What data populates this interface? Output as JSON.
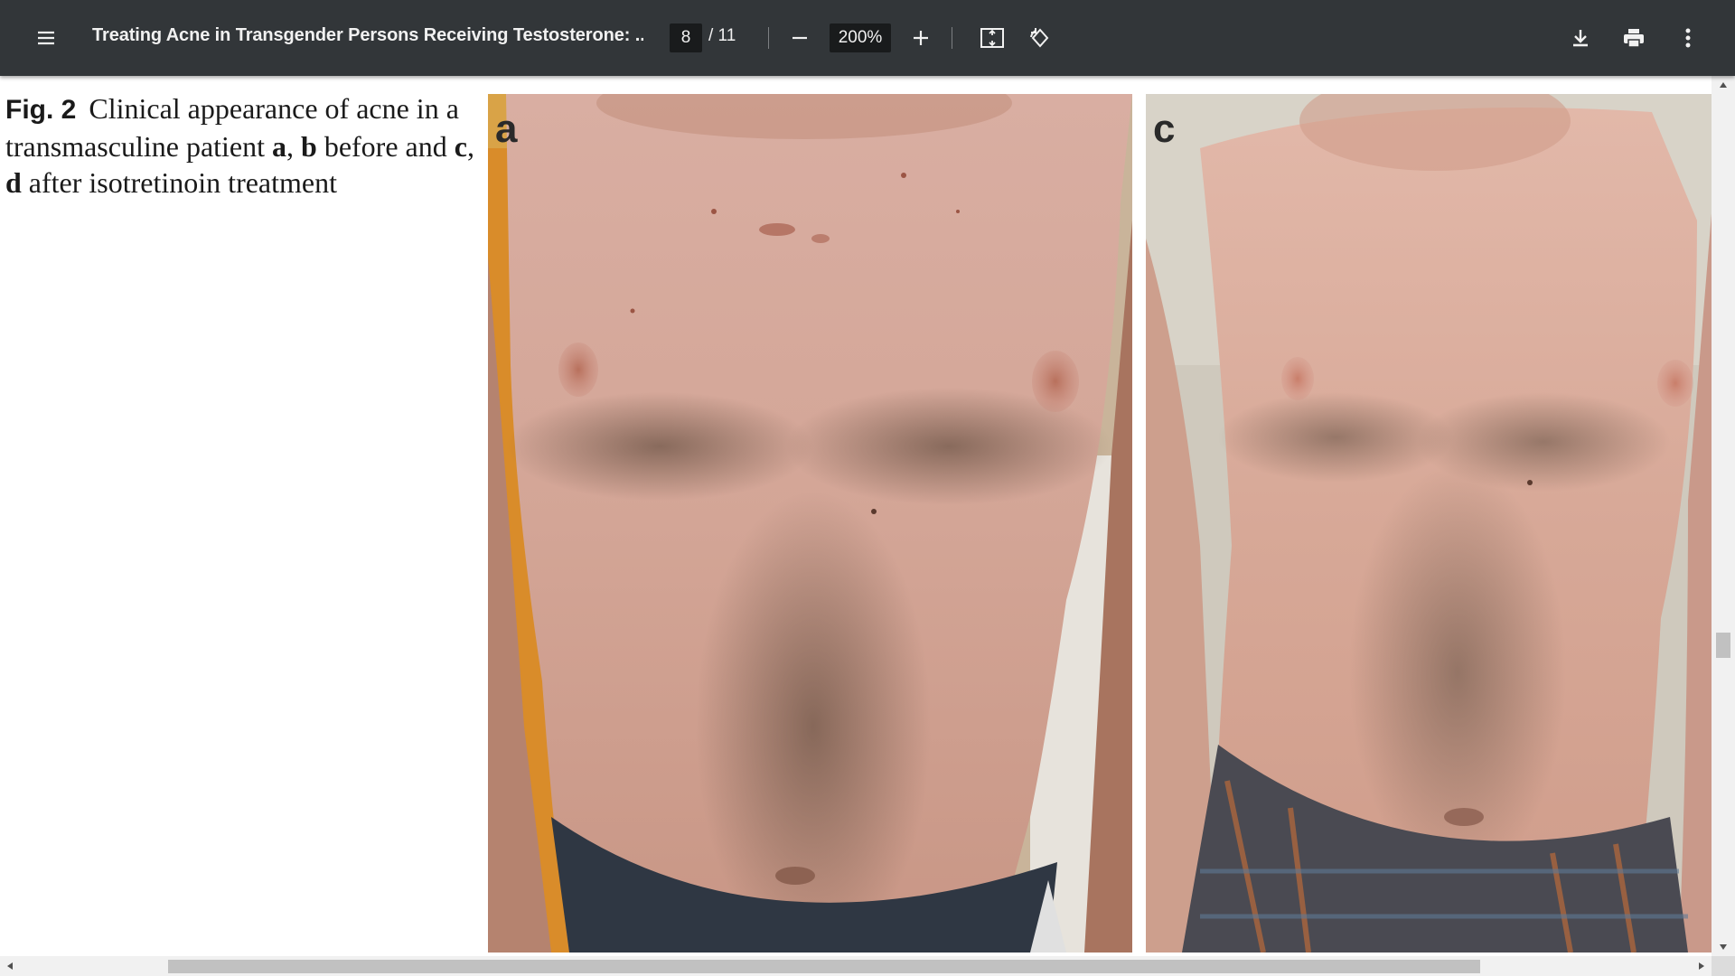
{
  "toolbar": {
    "menu_icon": "hamburger-menu-icon",
    "title": "Treating Acne in Transgender Persons Receiving Testosterone: ...",
    "current_page": "8",
    "total_pages": "/ 11",
    "zoom_out_icon": "minus-icon",
    "zoom": "200%",
    "zoom_in_icon": "plus-icon",
    "fit_icon": "fit-to-page-icon",
    "rotate_icon": "rotate-counterclockwise-icon",
    "download_icon": "download-icon",
    "print_icon": "print-icon",
    "more_icon": "more-vertical-icon"
  },
  "figure": {
    "label": "Fig. 2",
    "caption_parts": [
      "Clinical appearance of acne in a transmasculine patient ",
      "a",
      ", ",
      "b",
      " before and ",
      "c",
      ", ",
      "d",
      " after isotretinoin treatment"
    ],
    "panel_left_letter": "a",
    "panel_right_letter": "c"
  },
  "colors": {
    "toolbar_bg": "#323639",
    "text_light": "#f1f1f1",
    "input_bg": "#191b1c",
    "scrollbar_track": "#f1f1f1",
    "scrollbar_thumb": "#c1c1c1"
  }
}
